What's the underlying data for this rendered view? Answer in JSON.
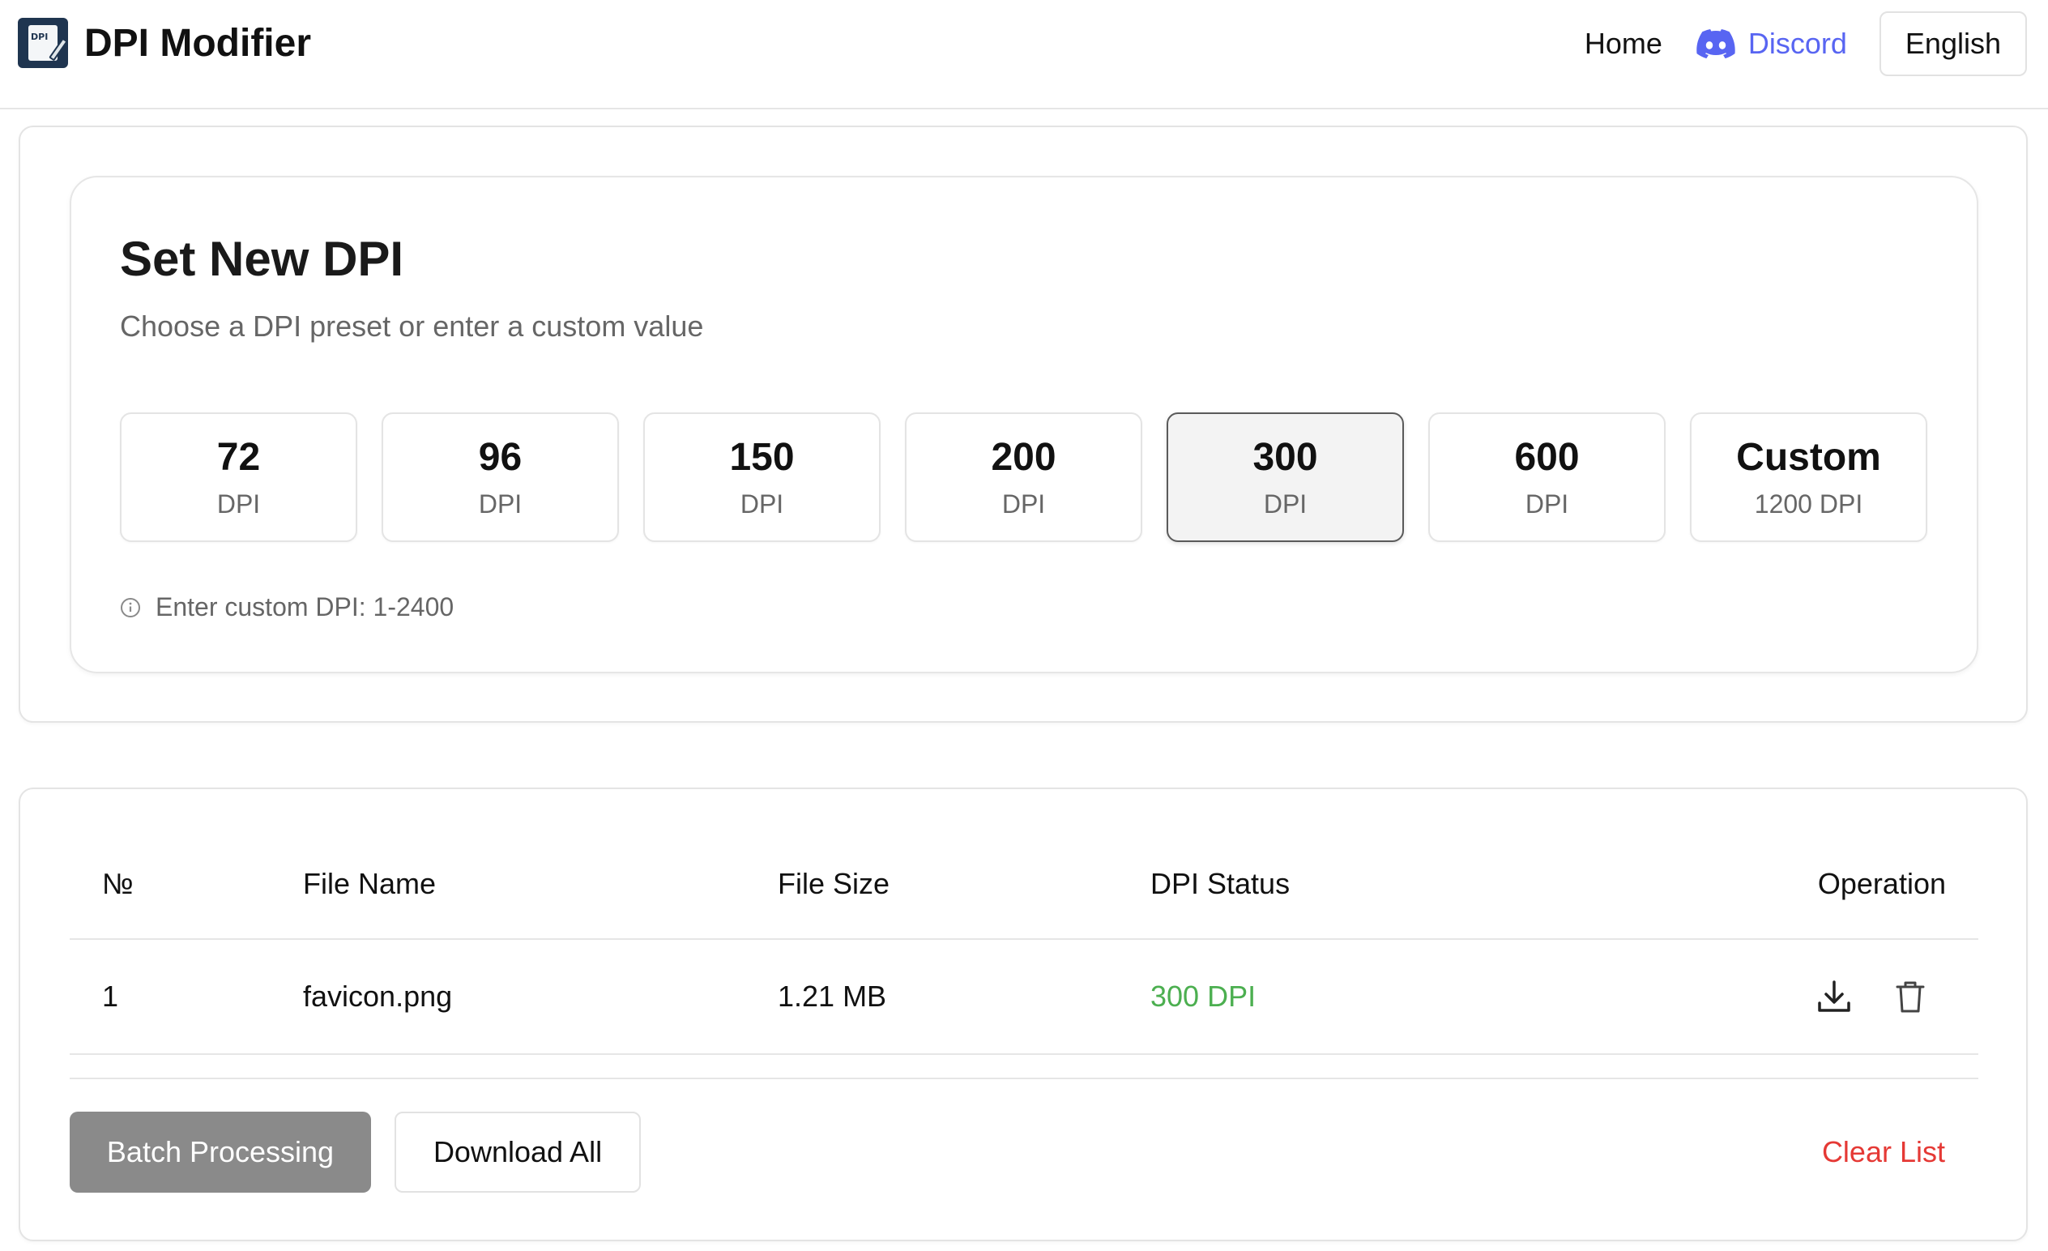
{
  "header": {
    "logo_text": "DPI",
    "title": "DPI Modifier",
    "nav_home": "Home",
    "nav_discord": "Discord",
    "language": "English"
  },
  "settings": {
    "title": "Set New DPI",
    "subtitle": "Choose a DPI preset or enter a custom value",
    "presets": [
      {
        "value": "72",
        "unit": "DPI",
        "selected": false
      },
      {
        "value": "96",
        "unit": "DPI",
        "selected": false
      },
      {
        "value": "150",
        "unit": "DPI",
        "selected": false
      },
      {
        "value": "200",
        "unit": "DPI",
        "selected": false
      },
      {
        "value": "300",
        "unit": "DPI",
        "selected": true
      },
      {
        "value": "600",
        "unit": "DPI",
        "selected": false
      },
      {
        "value": "Custom",
        "unit": "1200 DPI",
        "selected": false
      }
    ],
    "hint": "Enter custom DPI: 1-2400"
  },
  "table": {
    "headers": [
      "№",
      "File Name",
      "File Size",
      "DPI Status",
      "Operation"
    ],
    "rows": [
      {
        "no": "1",
        "name": "favicon.png",
        "size": "1.21 MB",
        "dpi": "300 DPI"
      }
    ]
  },
  "actions": {
    "batch": "Batch Processing",
    "download_all": "Download All",
    "clear": "Clear List"
  },
  "colors": {
    "discord": "#5865f2",
    "success": "#4caf50",
    "danger": "#e53935",
    "batch_bg": "#8a8a8a"
  }
}
